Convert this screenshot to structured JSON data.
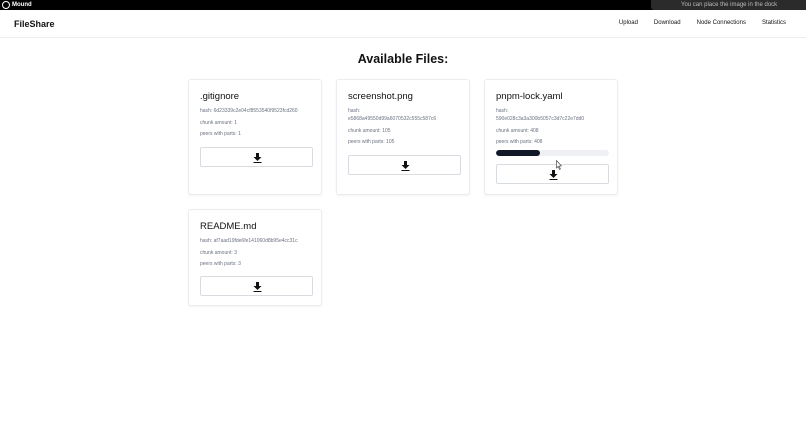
{
  "window": {
    "title": "Mound",
    "toast": "You can place the image in the dock"
  },
  "nav": {
    "brand": "FileShare",
    "links": [
      {
        "label": "Upload"
      },
      {
        "label": "Download"
      },
      {
        "label": "Node Connections"
      },
      {
        "label": "Statistics"
      }
    ]
  },
  "main": {
    "heading": "Available Files:",
    "files": [
      {
        "name": ".gitignore",
        "hash_label": "hash:",
        "hash": "6d23339c2e04cf8553540f9523fcd260",
        "chunk_label": "chunk amount:",
        "chunk_amount": "1",
        "peers_label": "peers with parts:",
        "peers": "1"
      },
      {
        "name": "screenshot.png",
        "hash_label": "hash:",
        "hash": "e5868a49550d99a6070532c555c587c6",
        "chunk_label": "chunk amount:",
        "chunk_amount": "105",
        "peers_label": "peers with parts:",
        "peers": "105"
      },
      {
        "name": "pnpm-lock.yaml",
        "hash_label": "hash:",
        "hash": "590e028c3a3a300b5057c3d7c22e7dd0",
        "chunk_label": "chunk amount:",
        "chunk_amount": "408",
        "peers_label": "peers with parts:",
        "peers": "408",
        "progress": 0.39
      },
      {
        "name": "README.md",
        "hash_label": "hash:",
        "hash": "af7aad19fde6fe141060d8b95e4cc31c",
        "chunk_label": "chunk amount:",
        "chunk_amount": "3",
        "peers_label": "peers with parts:",
        "peers": "3"
      }
    ],
    "download_icon": "download-icon"
  }
}
